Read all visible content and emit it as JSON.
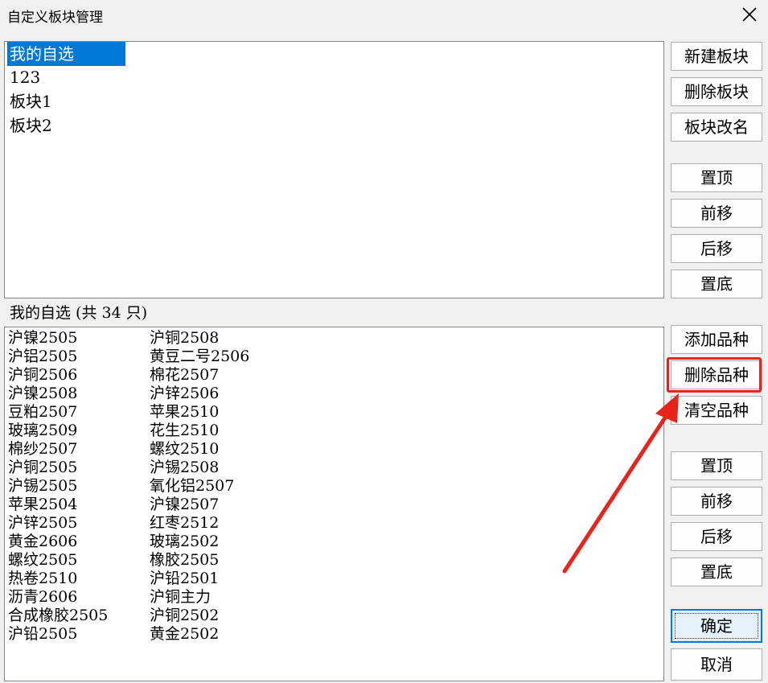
{
  "window": {
    "title": "自定义板块管理"
  },
  "boards": {
    "items": [
      "我的自选",
      "123",
      "板块1",
      "板块2"
    ],
    "selected_index": 0
  },
  "board_buttons": [
    "新建板块",
    "删除板块",
    "板块改名",
    "置顶",
    "前移",
    "后移",
    "置底"
  ],
  "variety_section": {
    "label": "我的自选 (共 34 只)"
  },
  "varieties": [
    [
      "沪镍2505",
      "沪铜2508"
    ],
    [
      "沪铝2505",
      "黄豆二号2506"
    ],
    [
      "沪铜2506",
      "棉花2507"
    ],
    [
      "沪镍2508",
      "沪锌2506"
    ],
    [
      "豆粕2507",
      "苹果2510"
    ],
    [
      "玻璃2509",
      "花生2510"
    ],
    [
      "棉纱2507",
      "螺纹2510"
    ],
    [
      "沪铜2505",
      "沪锡2508"
    ],
    [
      "沪锡2505",
      "氧化铝2507"
    ],
    [
      "苹果2504",
      "沪镍2507"
    ],
    [
      "沪锌2505",
      "红枣2512"
    ],
    [
      "黄金2606",
      "玻璃2502"
    ],
    [
      "螺纹2505",
      "橡胶2505"
    ],
    [
      "热卷2510",
      "沪铅2501"
    ],
    [
      "沥青2606",
      "沪铜主力"
    ],
    [
      "合成橡胶2505",
      "沪铜2502"
    ],
    [
      "沪铅2505",
      "黄金2502"
    ]
  ],
  "variety_buttons": [
    "添加品种",
    "删除品种",
    "清空品种",
    "置顶",
    "前移",
    "后移",
    "置底"
  ],
  "dialog_buttons": {
    "ok": "确定",
    "cancel": "取消"
  },
  "annotation": {
    "highlight_color": "#e8231a",
    "highlighted_button": "删除品种"
  }
}
